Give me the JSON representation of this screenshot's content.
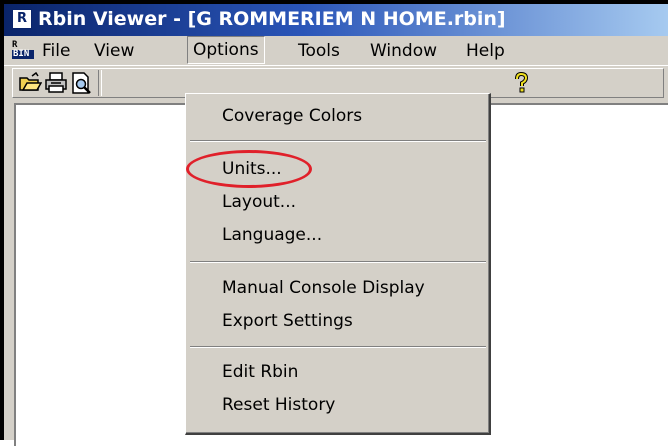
{
  "window": {
    "app_icon_letter": "R",
    "title": "Rbin Viewer - [G ROMMERIEM N HOME.rbin]"
  },
  "menubar": {
    "doc_icon": {
      "top": "R",
      "bottom": "BIN"
    },
    "items": [
      {
        "label": "File"
      },
      {
        "label": "View"
      },
      {
        "label": "Options",
        "open": true
      },
      {
        "label": "Tools"
      },
      {
        "label": "Window"
      },
      {
        "label": "Help"
      }
    ]
  },
  "toolbar": {
    "buttons": [
      "open-folder-icon",
      "print-icon",
      "print-preview-icon",
      "help-icon"
    ]
  },
  "options_menu": {
    "groups": [
      [
        "Coverage Colors"
      ],
      [
        "Units...",
        "Layout...",
        "Language..."
      ],
      [
        "Manual Console Display",
        "Export Settings"
      ],
      [
        "Edit Rbin",
        "Reset History"
      ]
    ],
    "highlighted_item": "Units...",
    "highlight_color": "#e0202a"
  },
  "colors": {
    "titlebar_start": "#0a246a",
    "titlebar_end": "#a6caf0",
    "chrome": "#d4d0c8",
    "client": "#ffffff"
  }
}
